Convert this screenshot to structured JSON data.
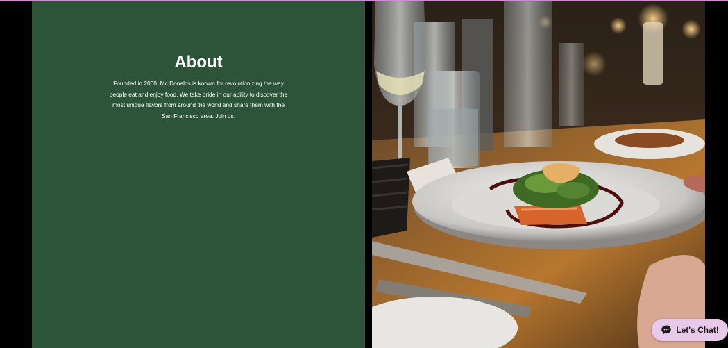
{
  "about": {
    "title": "About",
    "body": "Founded in 2000, Mc Donalds is known for revolutionizing the way people eat and enjoy food. We take pride in our ability to discover the most unique flavors from around the world and share them with the San Francisco area. Join us."
  },
  "photo": {
    "subject": "plated-dish-restaurant-table"
  },
  "chat": {
    "label": "Let's Chat!",
    "icon": "chat-bubble-icon"
  },
  "colors": {
    "panel_green": "#2b5439",
    "chat_background": "#e9c9ea",
    "top_accent": "#c892c8"
  }
}
